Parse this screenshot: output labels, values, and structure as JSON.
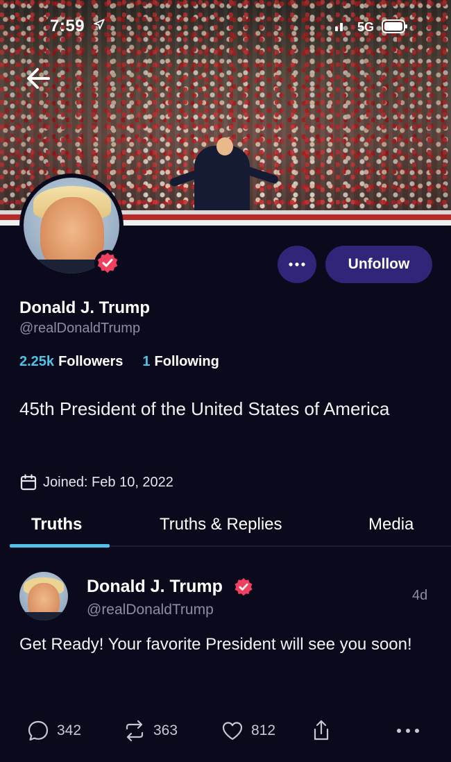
{
  "status_bar": {
    "time": "7:59",
    "network": "5G"
  },
  "profile": {
    "display_name": "Donald J. Trump",
    "handle": "@realDonaldTrump",
    "followers_count": "2.25k",
    "followers_label": "Followers",
    "following_count": "1",
    "following_label": "Following",
    "bio": "45th President of the United States of America",
    "joined": "Joined: Feb 10, 2022",
    "verified": true
  },
  "actions": {
    "more_label": "•••",
    "unfollow_label": "Unfollow"
  },
  "tabs": [
    {
      "label": "Truths",
      "active": true
    },
    {
      "label": "Truths & Replies",
      "active": false
    },
    {
      "label": "Media",
      "active": false
    }
  ],
  "post": {
    "author_name": "Donald J. Trump",
    "author_handle": "@realDonaldTrump",
    "time": "4d",
    "text": "Get Ready! Your favorite President will see you soon!",
    "replies": "342",
    "retruths": "363",
    "likes": "812"
  },
  "colors": {
    "background": "#0b0a1c",
    "accent": "#4fc3e8",
    "button": "#2f2679",
    "verified_badge": "#f0405f",
    "muted_text": "#8e8ea3"
  },
  "icons": {
    "back": "arrow-left-icon",
    "location": "location-arrow-icon",
    "signal": "signal-icon",
    "battery": "battery-icon",
    "verified": "verified-badge-icon",
    "calendar": "calendar-icon",
    "reply": "comment-icon",
    "retruth": "repost-icon",
    "like": "heart-icon",
    "share": "share-icon",
    "more": "more-horizontal-icon"
  }
}
